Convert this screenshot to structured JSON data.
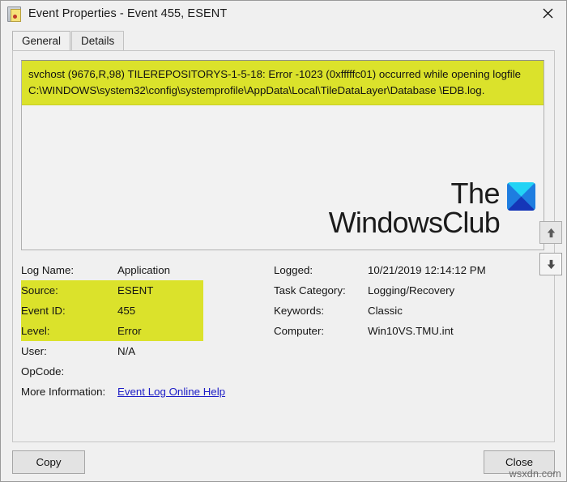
{
  "window": {
    "title": "Event Properties - Event 455, ESENT",
    "icon": "event-log-icon",
    "close_label": "✕"
  },
  "tabs": [
    {
      "label": "General",
      "active": true
    },
    {
      "label": "Details",
      "active": false
    }
  ],
  "description": {
    "highlighted": true,
    "highlight_color": "#dbe22b",
    "lines": [
      "svchost (9676,R,98) TILEREPOSITORYS-1-5-18: Error -1023 (0xfffffc01) occurred while opening",
      "logfile C:\\WINDOWS\\system32\\config\\systemprofile\\AppData\\Local\\TileDataLayer\\Database",
      "\\EDB.log."
    ]
  },
  "watermark": {
    "line1": "The",
    "line2": "WindowsClub",
    "logo_colors": {
      "top": "#22d3f5",
      "left": "#1e7de0",
      "right": "#1e7de0",
      "bottom": "#1536b8"
    }
  },
  "nav_buttons": [
    {
      "name": "previous-event-button",
      "glyph": "up-arrow-icon"
    },
    {
      "name": "next-event-button",
      "glyph": "down-arrow-icon"
    }
  ],
  "details": {
    "left": [
      {
        "label": "Log Name:",
        "value": "Application",
        "highlighted": false
      },
      {
        "label": "Source:",
        "value": "ESENT",
        "highlighted": true
      },
      {
        "label": "Event ID:",
        "value": "455",
        "highlighted": true
      },
      {
        "label": "Level:",
        "value": "Error",
        "highlighted": true
      },
      {
        "label": "User:",
        "value": "N/A",
        "highlighted": false
      },
      {
        "label": "OpCode:",
        "value": "",
        "highlighted": false
      }
    ],
    "more_information": {
      "label": "More Information:",
      "link_text": "Event Log Online Help"
    },
    "right": [
      {
        "label": "Logged:",
        "value": "10/21/2019 12:14:12 PM"
      },
      {
        "label": "Task Category:",
        "value": "Logging/Recovery"
      },
      {
        "label": "Keywords:",
        "value": "Classic"
      },
      {
        "label": "Computer:",
        "value": "Win10VS.TMU.int"
      }
    ]
  },
  "footer": {
    "copy_label": "Copy",
    "close_label": "Close"
  },
  "site_watermark": "wsxdn.com"
}
